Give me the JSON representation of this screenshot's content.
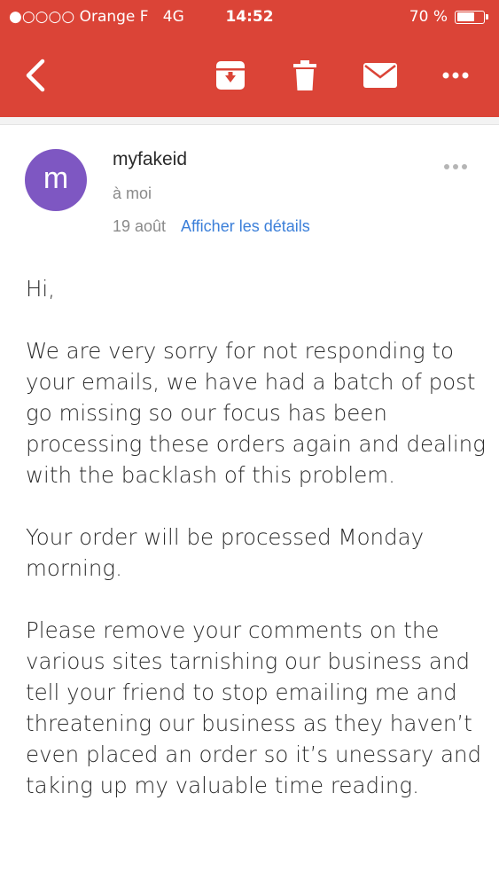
{
  "status_bar": {
    "carrier": "●○○○○ Orange F",
    "network": "4G",
    "time": "14:52",
    "battery_text": "70 %",
    "battery_level": 0.7
  },
  "toolbar": {
    "icons": [
      "back-icon",
      "archive-icon",
      "trash-icon",
      "mail-icon",
      "more-icon"
    ],
    "background_color": "#db4437"
  },
  "message": {
    "avatar_letter": "m",
    "avatar_color": "#7e57c2",
    "sender": "myfakeid",
    "recipient": "à moi",
    "date": "19 août",
    "details_link": "Afficher les détails",
    "body": [
      "Hi,",
      "We are very sorry for not responding to your emails, we have had a batch of post go missing so our focus has been processing these orders again and dealing with the backlash of this problem.",
      "Your order will be processed Monday morning.",
      "Please remove your comments on the various sites tarnishing our business and tell your friend to stop emailing me and threatening our business as they haven’t even placed an order so it’s unessary and taking up my valuable time reading."
    ]
  }
}
